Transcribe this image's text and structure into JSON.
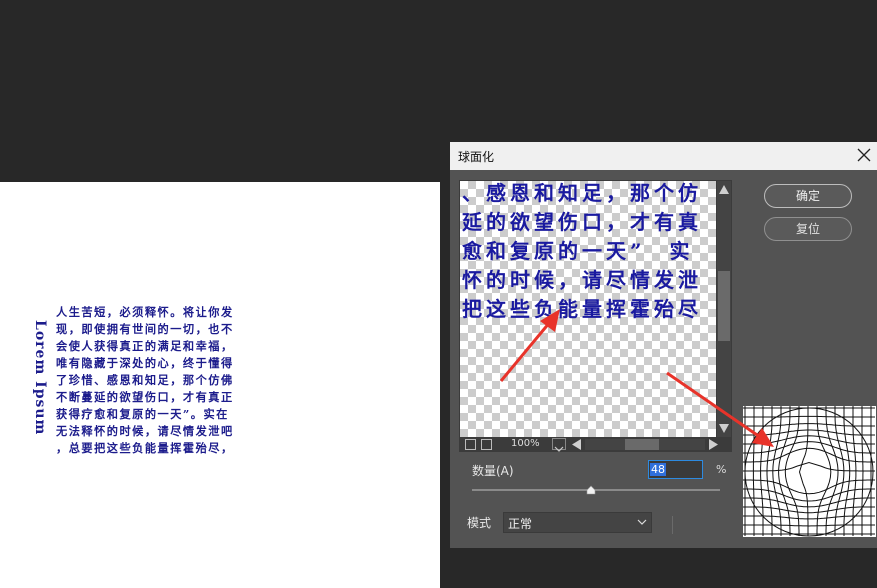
{
  "document": {
    "vertical_title": "Lorem Ipsum",
    "text_lines": [
      "人生苦短，必须释怀。将让你发",
      "现，即使拥有世间的一切，也不",
      "会使人获得真正的满足和幸福，",
      "唯有隐藏于深处的心，终于懂得",
      "了珍惜、感恩和知足，那个仿佛",
      "不断蔓延的欲望伤口，才有真正",
      "获得疗愈和复原的一天”。实在",
      "无法释怀的时候，请尽情发泄吧",
      "，总要把这些负能量挥霍殆尽，"
    ]
  },
  "dialog": {
    "title": "球面化",
    "preview_text_lines": [
      "、感恩和知足，那个仿",
      "延的欲望伤口，才有真",
      "愈和复原的一天”　实",
      "怀的时候，请尽情发泄",
      "把这些负能量挥霍殆尽"
    ],
    "zoom_level": "100%",
    "ok_label": "确定",
    "reset_label": "复位",
    "amount_label": "数量(A)",
    "amount_value": "48",
    "amount_unit": "%",
    "amount_fraction": 0.48,
    "mode_label": "模式",
    "mode_value": "正常"
  },
  "colors": {
    "text_blue": "#1c1c8c",
    "arrow_red": "#e8332a",
    "accent_blue": "#2f6fdc"
  }
}
